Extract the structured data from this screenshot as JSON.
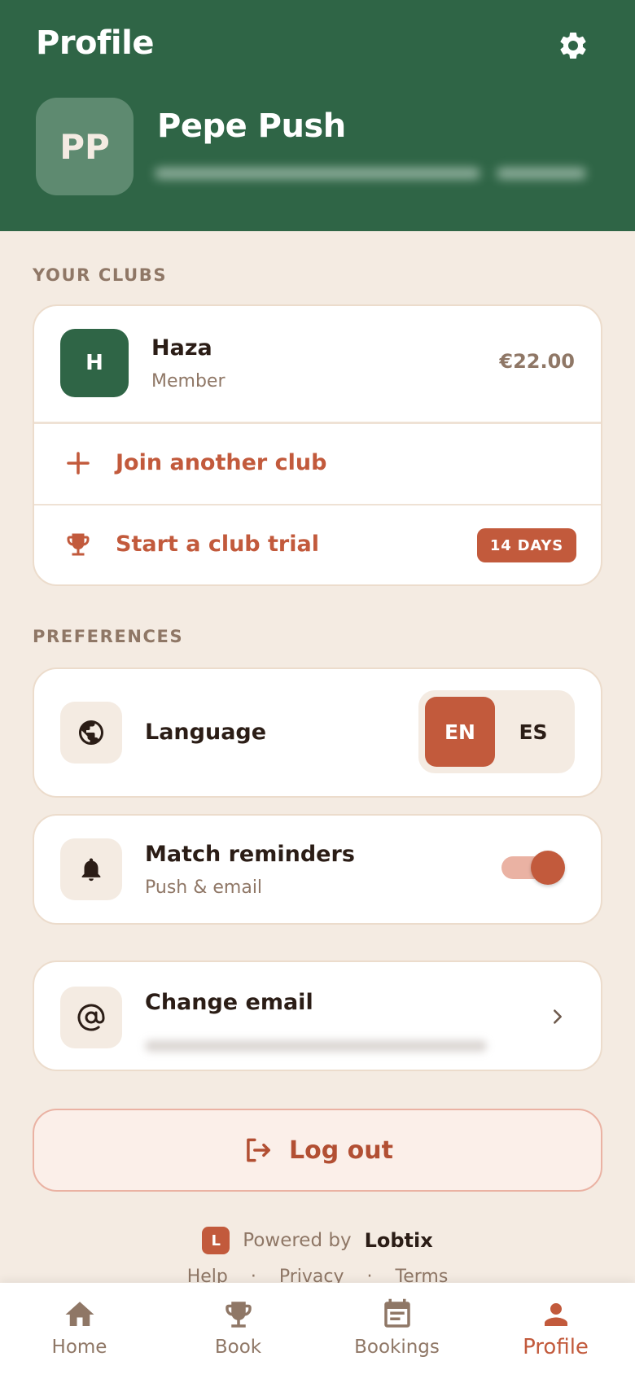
{
  "header": {
    "title": "Profile",
    "avatar_initials": "PP",
    "user_name": "Pepe Push",
    "settings_icon": "gear-icon"
  },
  "clubs_section": {
    "label": "YOUR CLUBS",
    "clubs": [
      {
        "initial": "H",
        "name": "Haza",
        "role": "Member",
        "balance": "€22.00"
      }
    ],
    "join_label": "Join another club",
    "trial_label": "Start a club trial",
    "trial_badge": "14 DAYS"
  },
  "preferences_section": {
    "label": "PREFERENCES",
    "language": {
      "title": "Language",
      "options": [
        "EN",
        "ES"
      ],
      "selected": "EN"
    },
    "reminders": {
      "title": "Match reminders",
      "subtitle": "Push & email",
      "enabled": true
    },
    "change_email": {
      "title": "Change email"
    }
  },
  "logout": {
    "label": "Log out"
  },
  "powered_by": {
    "logo_letter": "L",
    "text": "Powered by",
    "brand": "Lobtix"
  },
  "footer_links": [
    "Help",
    "·",
    "Privacy",
    "·",
    "Terms"
  ],
  "tabbar": {
    "tabs": [
      {
        "label": "Home",
        "icon": "home-icon"
      },
      {
        "label": "Book",
        "icon": "trophy-icon"
      },
      {
        "label": "Bookings",
        "icon": "calendar-icon"
      },
      {
        "label": "Profile",
        "icon": "person-icon"
      }
    ],
    "active": "Profile"
  },
  "colors": {
    "primary_green": "#2f6546",
    "accent": "#c25a3c",
    "background": "#f4ebe2"
  }
}
